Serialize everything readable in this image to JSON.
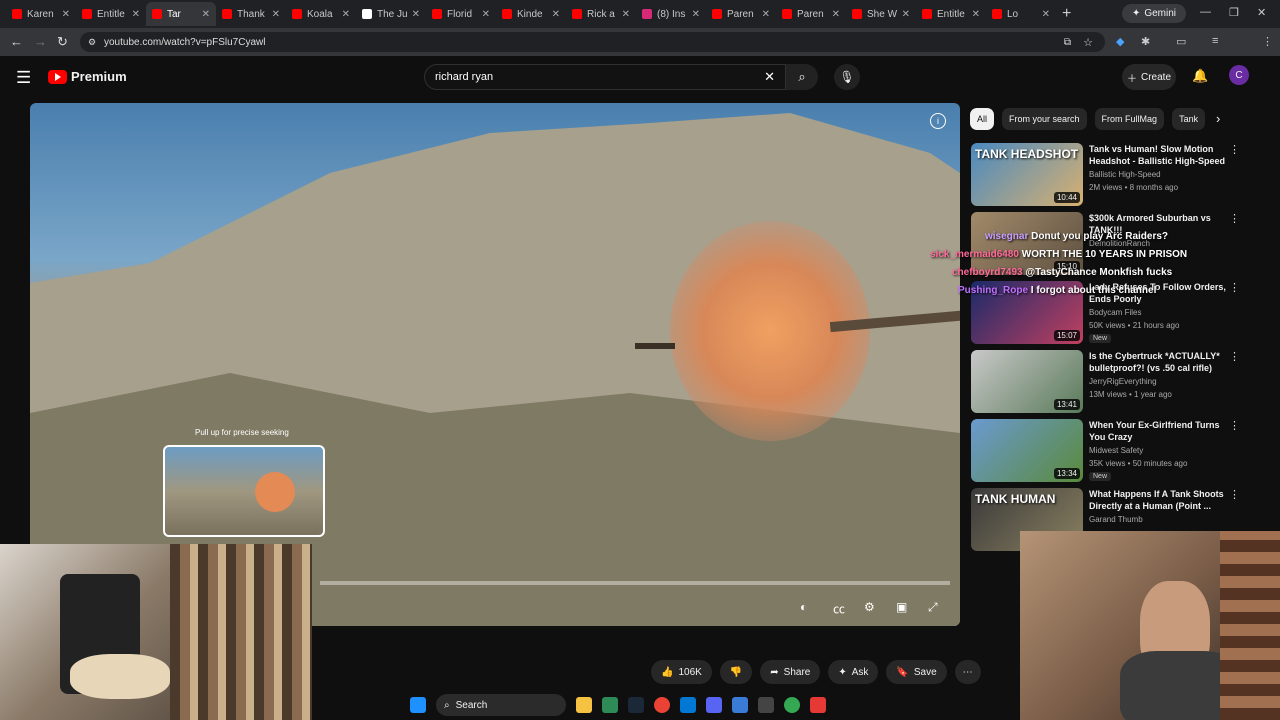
{
  "browser": {
    "tabs": [
      {
        "label": "Karen",
        "color": "#ff0000"
      },
      {
        "label": "Entitle",
        "color": "#ff0000"
      },
      {
        "label": "Tar",
        "color": "#ff0000",
        "active": true
      },
      {
        "label": "Thank",
        "color": "#ff0000"
      },
      {
        "label": "Koala",
        "color": "#ff0000"
      },
      {
        "label": "The Ju",
        "color": "#ffffff"
      },
      {
        "label": "Florid",
        "color": "#ff0000"
      },
      {
        "label": "Kinde",
        "color": "#ff0000"
      },
      {
        "label": "Rick a",
        "color": "#ff0000"
      },
      {
        "label": "(8) Ins",
        "color": "#d62976"
      },
      {
        "label": "Paren",
        "color": "#ff0000"
      },
      {
        "label": "Paren",
        "color": "#ff0000"
      },
      {
        "label": "She W",
        "color": "#ff0000"
      },
      {
        "label": "Entitle",
        "color": "#ff0000"
      },
      {
        "label": "Lo",
        "color": "#ff0000"
      }
    ],
    "new_tab": "+",
    "gemini_label": "Gemini",
    "url": "youtube.com/watch?v=pFSlu7Cyawl"
  },
  "header": {
    "logo_label": "Premium",
    "search_value": "richard ryan",
    "create_label": "Create",
    "avatar_letter": "C"
  },
  "player": {
    "seek_hint": "Pull up for precise seeking"
  },
  "chips": [
    "All",
    "From your search",
    "From FullMag",
    "Tank"
  ],
  "recommendations": [
    {
      "thumb_text": "TANK HEADSHOT",
      "duration": "10:44",
      "title": "Tank vs Human! Slow Motion Headshot - Ballistic High-Speed",
      "channel": "Ballistic High-Speed",
      "meta": "2M views • 8 months ago"
    },
    {
      "thumb_text": "",
      "duration": "15:10",
      "title": "$300k Armored Suburban vs TANK!!!",
      "channel": "DemolitionRanch",
      "meta": ""
    },
    {
      "thumb_text": "",
      "duration": "15:07",
      "title": "Lady Refuses To Follow Orders, Ends Poorly",
      "channel": "Bodycam Files",
      "meta": "50K views • 21 hours ago",
      "badge": "New"
    },
    {
      "thumb_text": "",
      "duration": "13:41",
      "title": "Is the Cybertruck *ACTUALLY* bulletproof?! (vs .50 cal rifle)",
      "channel": "JerryRigEverything",
      "meta": "13M views • 1 year ago"
    },
    {
      "thumb_text": "",
      "duration": "13:34",
      "title": "When Your Ex-Girlfriend Turns You Crazy",
      "channel": "Midwest Safety",
      "meta": "35K views • 50 minutes ago",
      "badge": "New"
    },
    {
      "thumb_text": "TANK HUMAN",
      "duration": "",
      "title": "What Happens If A Tank Shoots Directly at a Human (Point ...",
      "channel": "Garand Thumb",
      "meta": ""
    }
  ],
  "chat": [
    {
      "user": "wisegnar",
      "text": "Donut you play Arc Raiders?",
      "color": "#c9a0ff"
    },
    {
      "user": "sick_mermaid6480",
      "text": "WORTH THE 10 YEARS IN PRISON",
      "color": "#ff6b9a"
    },
    {
      "user": "chefboyrd7493",
      "text": "@TastyChance Monkfish fucks",
      "color": "#ff6b9a"
    },
    {
      "user": "Pushing_Rope",
      "text": "I forgot about this channel",
      "color": "#c070ff"
    }
  ],
  "actions": {
    "likes": "106K",
    "share_label": "Share",
    "ask_label": "Ask",
    "save_label": "Save"
  },
  "taskbar": {
    "search_label": "Search"
  }
}
